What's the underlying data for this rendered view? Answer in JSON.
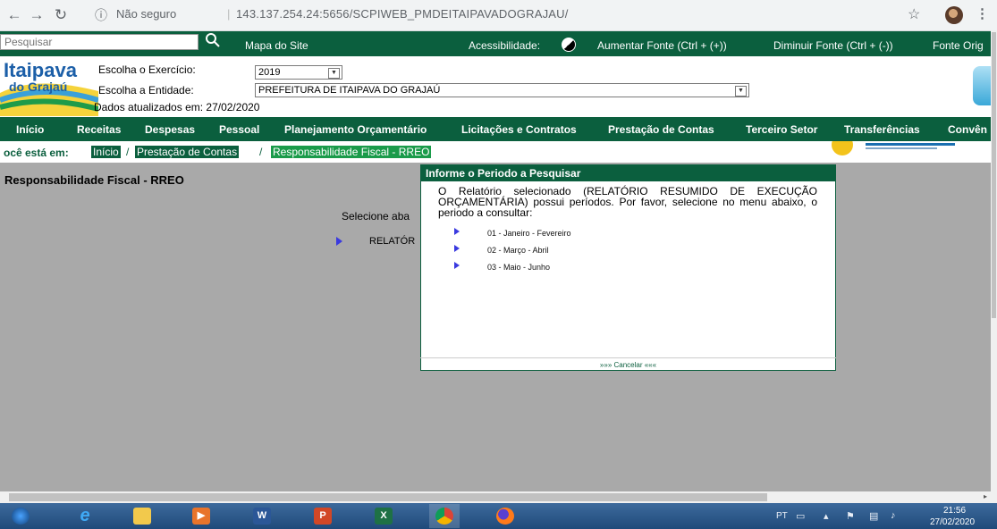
{
  "browser": {
    "security_label": "Não seguro",
    "url": "143.137.254.24:5656/SCPIWEB_PMDEITAIPAVADOGRAJAU/"
  },
  "topbar": {
    "search_placeholder": "Pesquisar",
    "site_map": "Mapa do Site",
    "accessibility": "Acessibilidade:",
    "increase_font": "Aumentar Fonte (Ctrl + (+))",
    "decrease_font": "Diminuir Fonte (Ctrl + (-))",
    "original_font": "Fonte Orig"
  },
  "header": {
    "logo_text": "Itaipava do Grajaú",
    "exercise_label": "Escolha o Exercício:",
    "exercise_value": "2019",
    "entity_label": "Escolha a Entidade:",
    "entity_value": "PREFEITURA DE ITAIPAVA DO GRAJAÚ",
    "updated": "Dados atualizados em: 27/02/2020"
  },
  "nav": [
    "Início",
    "Receitas",
    "Despesas",
    "Pessoal",
    "Planejamento Orçamentário",
    "Licitações e Contratos",
    "Prestação de Contas",
    "Terceiro Setor",
    "Transferências",
    "Convên"
  ],
  "breadcrumb": {
    "prefix": "ocê está em:",
    "items": [
      "Início",
      "Prestação de Contas",
      "Responsabilidade Fiscal - RREO"
    ]
  },
  "page": {
    "title": "Responsabilidade Fiscal - RREO",
    "selecione": "Selecione aba",
    "relatorio": "RELATÓR"
  },
  "modal": {
    "title": "Informe o Periodo a Pesquisar",
    "message": "O Relatório selecionado (RELATÓRIO RESUMIDO DE EXECUÇÃO ORÇAMENTÁRIA) possui períodos. Por favor, selecione no menu abaixo, o periodo a consultar:",
    "periods": [
      "01 - Janeiro - Fevereiro",
      "02 - Março - Abril",
      "03 - Maio - Junho"
    ],
    "cancel": "»»» Cancelar «««"
  },
  "taskbar": {
    "lang": "PT",
    "time": "21:56",
    "date": "27/02/2020"
  },
  "colors": {
    "brand_green": "#0b5f3e",
    "active_crumb": "#1a9b4a",
    "overlay_gray": "#a9a9a9"
  }
}
